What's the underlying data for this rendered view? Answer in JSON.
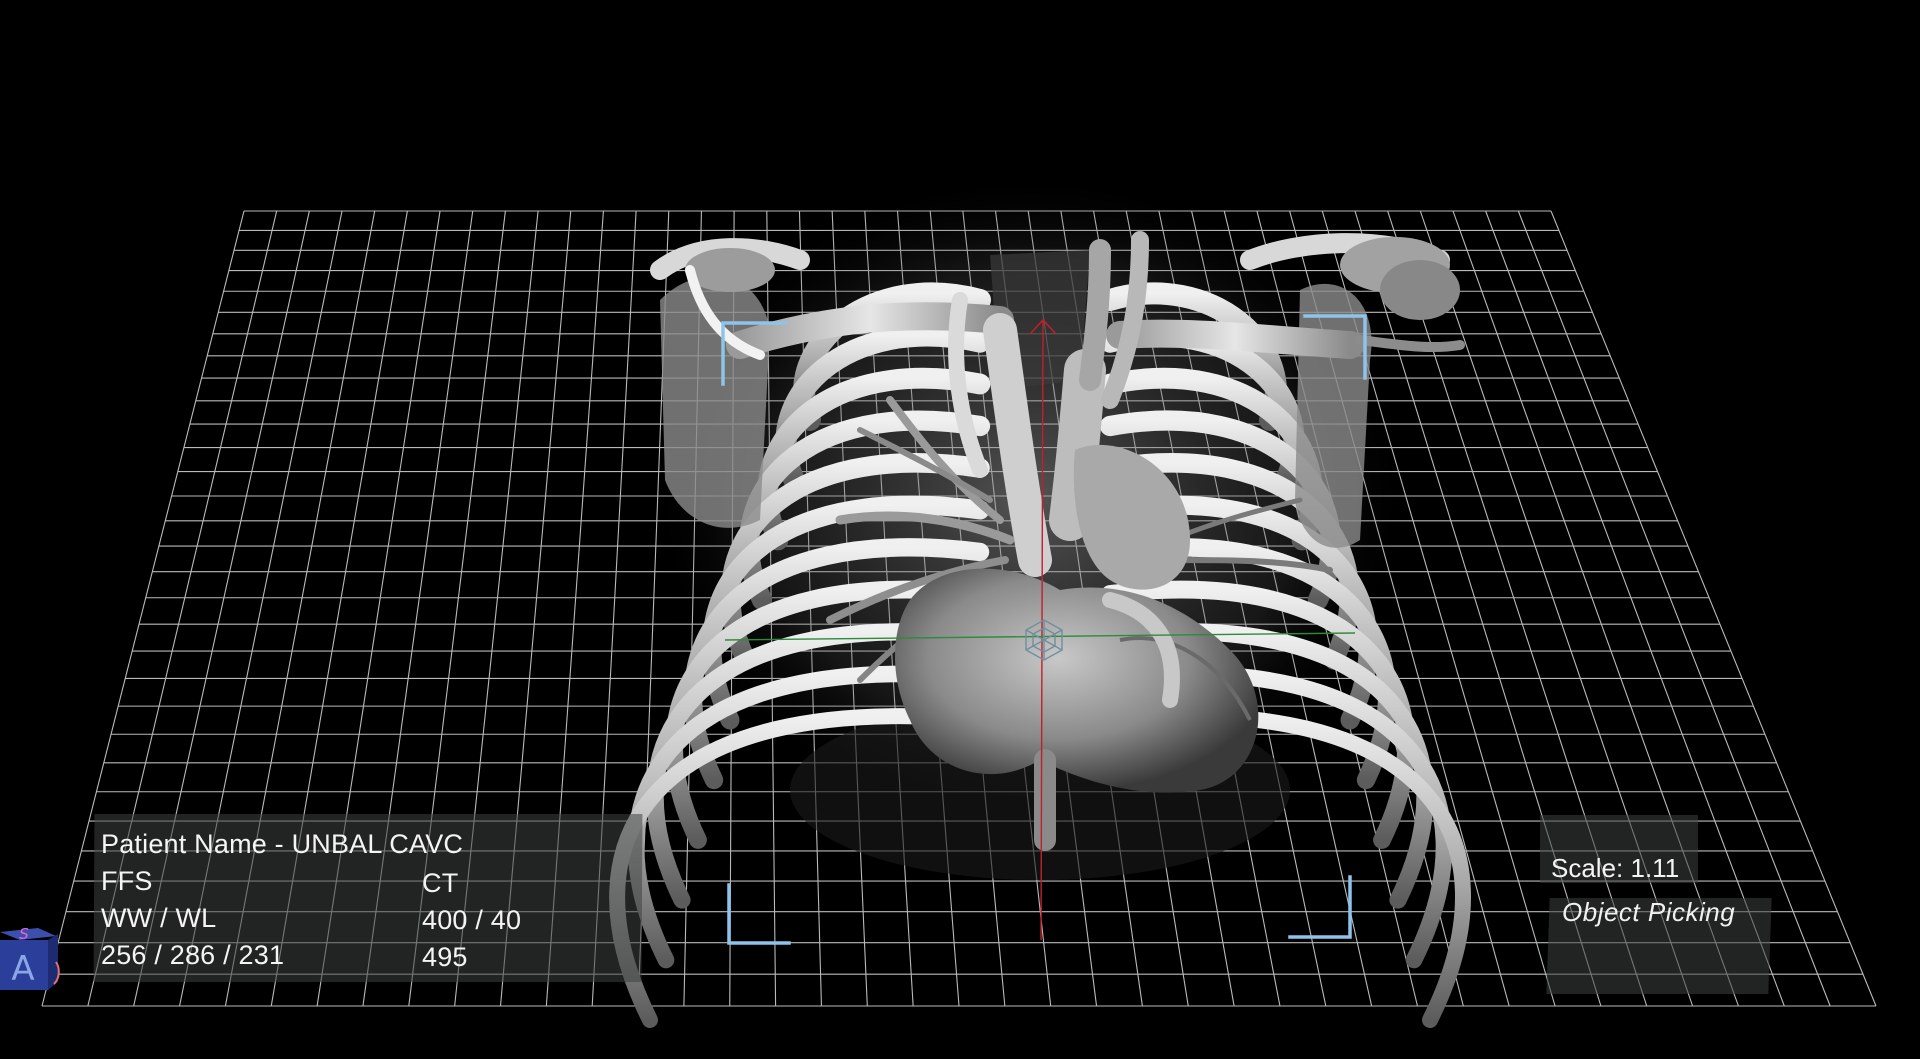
{
  "viewport": {
    "background": "#000000",
    "grid_color": "#cfcfcf",
    "selection_bracket_color": "#8fc3ea",
    "axis_vertical_color": "#c0202a",
    "axis_horizontal_color": "#2e8b3a"
  },
  "overlay": {
    "patient_name": "Patient Name - UNBAL CAVC",
    "orientation": "FFS",
    "modality": "CT",
    "ww_wl_label": "WW / WL",
    "ww_wl_value": "400 / 40",
    "dimensions": "256 / 286 / 231",
    "slices": "495"
  },
  "scale": {
    "label": "Scale: 1.11"
  },
  "tools": {
    "object_picking": "Object Picking"
  },
  "orientation_cube": {
    "top_face": "S",
    "front_face": "A",
    "icon": "orientation-cube-icon",
    "color": "#2b3f9a"
  }
}
